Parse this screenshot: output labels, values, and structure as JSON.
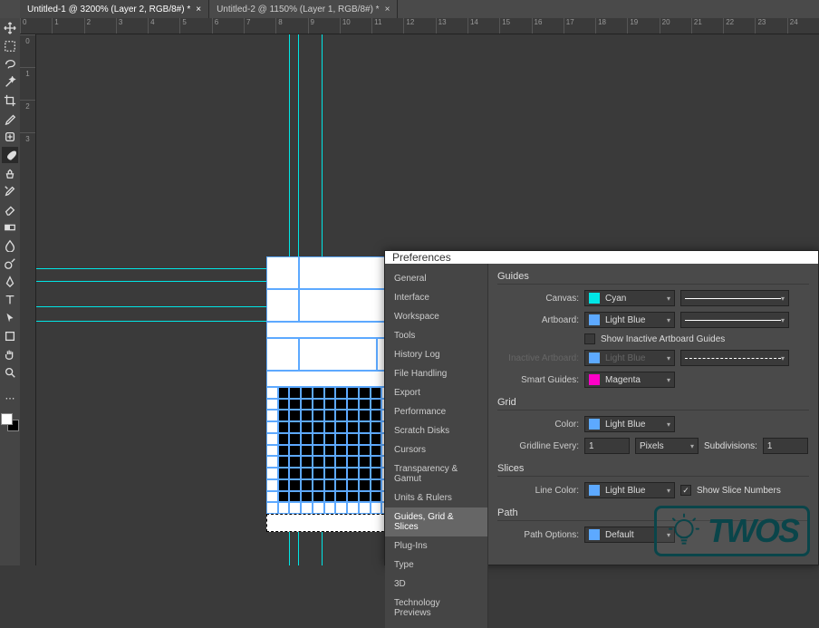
{
  "tabs": [
    {
      "label": "Untitled-1 @ 3200% (Layer 2, RGB/8#) *",
      "active": true
    },
    {
      "label": "Untitled-2 @ 1150% (Layer 1, RGB/8#) *",
      "active": false
    }
  ],
  "ruler_h": [
    "0",
    "1",
    "2",
    "3",
    "4",
    "5",
    "6",
    "7",
    "8",
    "9",
    "10",
    "11",
    "12",
    "13",
    "14",
    "15",
    "16",
    "17",
    "18",
    "19",
    "20",
    "21",
    "22",
    "23",
    "24"
  ],
  "ruler_v": [
    "0",
    "1",
    "2",
    "3"
  ],
  "tools": [
    "move",
    "marquee",
    "lasso",
    "wand",
    "crop",
    "eyedropper",
    "heal",
    "brush",
    "clone",
    "history-brush",
    "eraser",
    "gradient",
    "blur",
    "dodge",
    "pen",
    "type",
    "path-select",
    "rectangle",
    "hand",
    "zoom"
  ],
  "active_tool_index": 7,
  "prefs": {
    "title": "Preferences",
    "nav": [
      "General",
      "Interface",
      "Workspace",
      "Tools",
      "History Log",
      "File Handling",
      "Export",
      "Performance",
      "Scratch Disks",
      "Cursors",
      "Transparency & Gamut",
      "Units & Rulers",
      "Guides, Grid & Slices",
      "Plug-Ins",
      "Type",
      "3D",
      "Technology Previews"
    ],
    "nav_selected_index": 12,
    "guides": {
      "section": "Guides",
      "canvas_label": "Canvas:",
      "canvas_value": "Cyan",
      "canvas_swatch": "#00e5e5",
      "artboard_label": "Artboard:",
      "artboard_value": "Light Blue",
      "artboard_swatch": "#5da9ff",
      "show_inactive_label": "Show Inactive Artboard Guides",
      "show_inactive_checked": false,
      "inactive_label": "Inactive Artboard:",
      "inactive_value": "Light Blue",
      "inactive_swatch": "#5da9ff",
      "smart_label": "Smart Guides:",
      "smart_value": "Magenta",
      "smart_swatch": "#ff00c8"
    },
    "grid": {
      "section": "Grid",
      "color_label": "Color:",
      "color_value": "Light Blue",
      "color_swatch": "#5da9ff",
      "gridline_label": "Gridline Every:",
      "gridline_value": "1",
      "gridline_unit": "Pixels",
      "subdiv_label": "Subdivisions:",
      "subdiv_value": "1"
    },
    "slices": {
      "section": "Slices",
      "color_label": "Line Color:",
      "color_value": "Light Blue",
      "color_swatch": "#5da9ff",
      "show_numbers_label": "Show Slice Numbers",
      "show_numbers_checked": true
    },
    "path": {
      "section": "Path",
      "options_label": "Path Options:",
      "options_value": "Default",
      "options_swatch": "#5da9ff"
    }
  },
  "logo_text": "TWOS"
}
